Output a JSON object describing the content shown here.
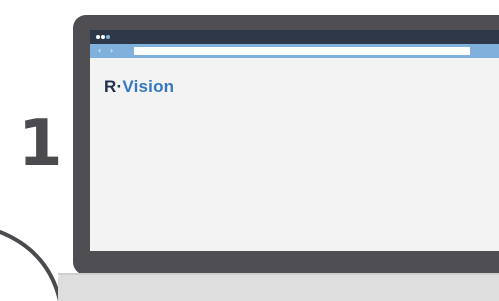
{
  "step": {
    "number": "1"
  },
  "browser": {
    "window_dots": [
      "window-dot",
      "window-dot",
      "window-dot-active"
    ],
    "nav": {
      "back_glyph": "‹",
      "forward_glyph": "›"
    },
    "address_value": ""
  },
  "brand": {
    "letter": "R",
    "separator": "·",
    "name": "Vision"
  },
  "colors": {
    "bezel": "#4e4e53",
    "titlebar": "#2f3848",
    "addressbar": "#7fb1dc",
    "screen": "#f3f3f3",
    "brand_dark": "#24304a",
    "brand_blue": "#3578c0",
    "step_number": "#4a4a4f",
    "base": "#dedede"
  }
}
